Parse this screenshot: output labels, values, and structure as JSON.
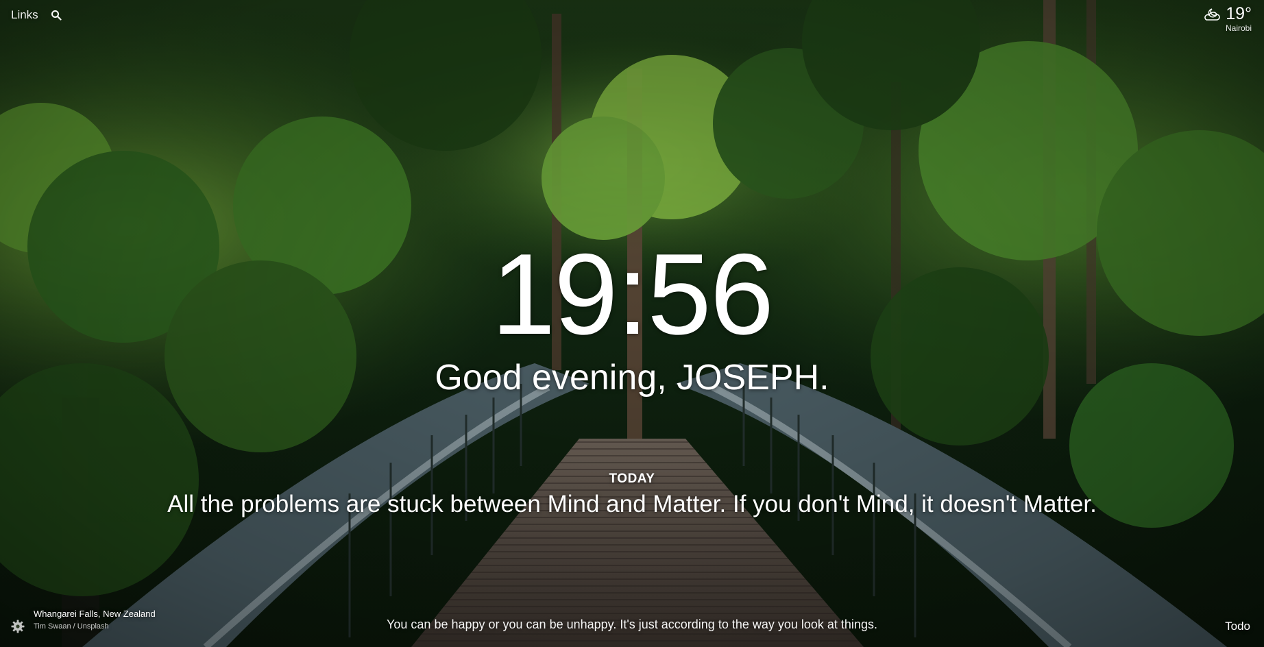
{
  "nav": {
    "links_label": "Links",
    "search_icon": "search-icon"
  },
  "weather": {
    "icon": "cloud-moon-icon",
    "temperature": "19°",
    "location": "Nairobi"
  },
  "clock": {
    "time": "19:56"
  },
  "greeting": {
    "text": "Good evening, JOSEPH."
  },
  "focus": {
    "label": "TODAY",
    "text": "All the problems are stuck between Mind and Matter. If you don't Mind, it doesn't Matter."
  },
  "footer": {
    "settings_icon": "gear-icon",
    "photo_location": "Whangarei Falls, New Zealand",
    "photo_credit": "Tim Swaan / Unsplash",
    "quote": "You can be happy or you can be unhappy. It's just according to the way you look at things.",
    "todo_label": "Todo"
  },
  "colors": {
    "text": "#ffffff",
    "foliage_dark": "#0f2410",
    "foliage_light": "#6ea83a",
    "bridge": "#5f7278"
  }
}
